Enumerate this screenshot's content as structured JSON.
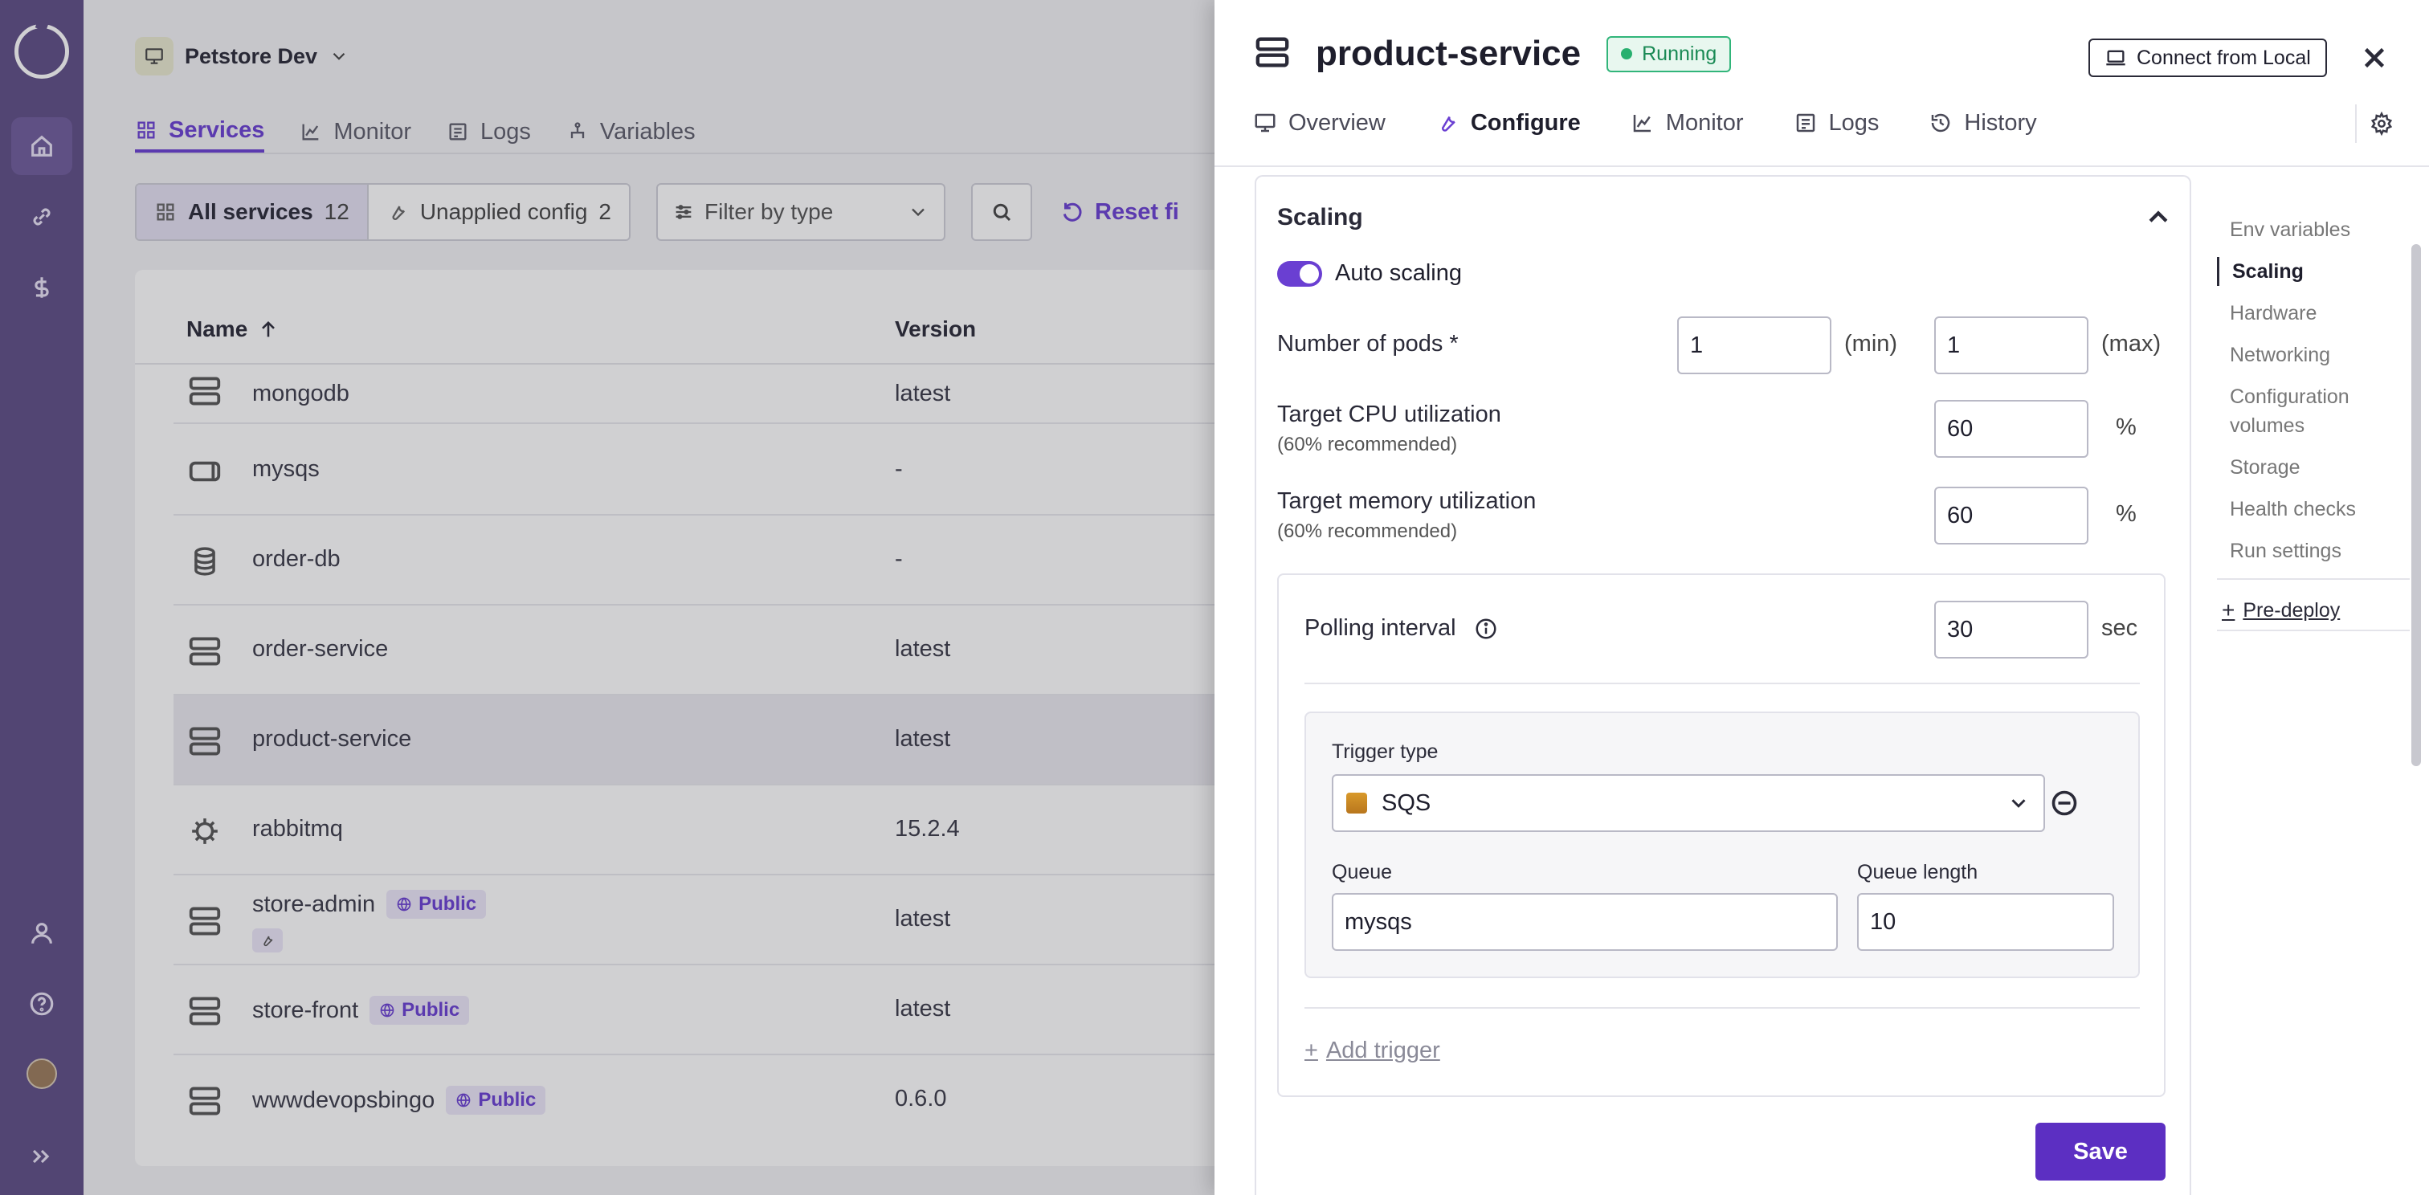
{
  "rail": {
    "items": [
      "home-icon",
      "link-icon",
      "dollar-icon",
      "user-icon",
      "help-icon",
      "avatar",
      "expand-icon"
    ]
  },
  "main": {
    "env_name": "Petstore Dev",
    "tabs": [
      {
        "label": "Services",
        "icon": "grid-icon"
      },
      {
        "label": "Monitor",
        "icon": "chart-icon"
      },
      {
        "label": "Logs",
        "icon": "logs-icon"
      },
      {
        "label": "Variables",
        "icon": "variables-icon"
      }
    ],
    "filters": {
      "all_services_label": "All services",
      "all_services_count": "12",
      "unapplied_label": "Unapplied config",
      "unapplied_count": "2",
      "filter_type_placeholder": "Filter by type",
      "reset_label": "Reset fi"
    },
    "table": {
      "headers": {
        "name": "Name",
        "version": "Version"
      },
      "rows": [
        {
          "name": "mongodb",
          "version": "latest",
          "icon": "server-icon",
          "public": false
        },
        {
          "name": "mysqs",
          "version": "-",
          "icon": "queue-icon",
          "public": false
        },
        {
          "name": "order-db",
          "version": "-",
          "icon": "database-icon",
          "public": false
        },
        {
          "name": "order-service",
          "version": "latest",
          "icon": "server-icon",
          "public": false
        },
        {
          "name": "product-service",
          "version": "latest",
          "icon": "server-icon",
          "public": false
        },
        {
          "name": "rabbitmq",
          "version": "15.2.4",
          "icon": "helm-icon",
          "public": false
        },
        {
          "name": "store-admin",
          "version": "latest",
          "icon": "server-icon",
          "public": true
        },
        {
          "name": "store-front",
          "version": "latest",
          "icon": "server-icon",
          "public": true
        },
        {
          "name": "wwwdevopsbingo",
          "version": "0.6.0",
          "icon": "server-icon",
          "public": true
        }
      ],
      "public_label": "Public"
    }
  },
  "panel": {
    "title": "product-service",
    "status": "Running",
    "connect_label": "Connect from Local",
    "tabs": [
      {
        "label": "Overview",
        "icon": "monitor-icon"
      },
      {
        "label": "Configure",
        "icon": "wrench-icon"
      },
      {
        "label": "Monitor",
        "icon": "chart-icon"
      },
      {
        "label": "Logs",
        "icon": "logs-icon"
      },
      {
        "label": "History",
        "icon": "history-icon"
      }
    ],
    "scaling": {
      "title": "Scaling",
      "auto_scaling_label": "Auto scaling",
      "auto_scaling_on": true,
      "pods_label": "Number of pods *",
      "pods_min": "1",
      "pods_min_unit": "(min)",
      "pods_max": "1",
      "pods_max_unit": "(max)",
      "cpu_label": "Target CPU utilization",
      "cpu_hint": "(60% recommended)",
      "cpu_value": "60",
      "cpu_unit": "%",
      "mem_label": "Target memory utilization",
      "mem_hint": "(60% recommended)",
      "mem_value": "60",
      "mem_unit": "%",
      "polling_label": "Polling interval",
      "polling_value": "30",
      "polling_unit": "sec",
      "trigger_type_label": "Trigger type",
      "trigger_type_value": "SQS",
      "queue_label": "Queue",
      "queue_value": "mysqs",
      "queue_length_label": "Queue length",
      "queue_length_value": "10",
      "add_trigger_label": "Add trigger"
    },
    "save_label": "Save",
    "side_nav": [
      {
        "label": "Env variables",
        "active": false
      },
      {
        "label": "Scaling",
        "active": true
      },
      {
        "label": "Hardware",
        "active": false
      },
      {
        "label": "Networking",
        "active": false
      },
      {
        "label": "Configuration volumes",
        "active": false
      },
      {
        "label": "Storage",
        "active": false
      },
      {
        "label": "Health checks",
        "active": false
      },
      {
        "label": "Run settings",
        "active": false
      }
    ],
    "predeploy_label": "Pre-deploy"
  },
  "colors": {
    "rail": "#5e4d86",
    "accent": "#6a3fd2",
    "save": "#5c2fc2",
    "running": "#28b06f"
  }
}
